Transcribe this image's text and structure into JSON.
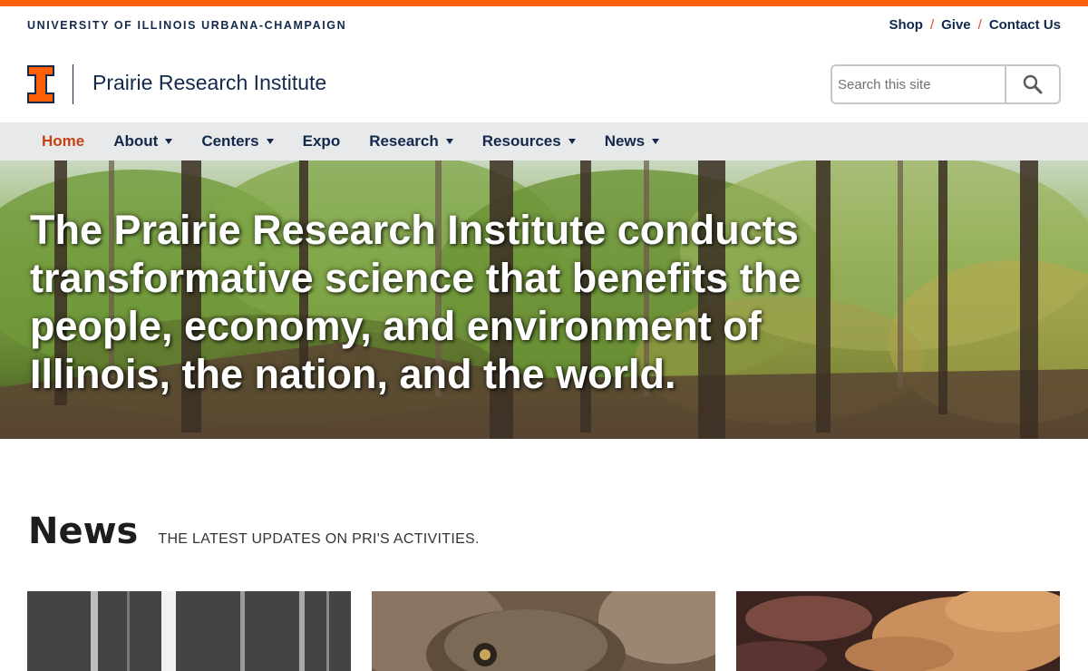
{
  "header": {
    "university": "UNIVERSITY OF ILLINOIS URBANA-CHAMPAIGN",
    "utility_links": [
      "Shop",
      "Give",
      "Contact Us"
    ],
    "site_title": "Prairie Research Institute",
    "search_placeholder": "Search this site"
  },
  "nav": {
    "items": [
      {
        "label": "Home",
        "active": true,
        "dropdown": false
      },
      {
        "label": "About",
        "active": false,
        "dropdown": true
      },
      {
        "label": "Centers",
        "active": false,
        "dropdown": true
      },
      {
        "label": "Expo",
        "active": false,
        "dropdown": false
      },
      {
        "label": "Research",
        "active": false,
        "dropdown": true
      },
      {
        "label": "Resources",
        "active": false,
        "dropdown": true
      },
      {
        "label": "News",
        "active": false,
        "dropdown": true
      }
    ]
  },
  "hero": {
    "text": "The Prairie Research Institute conducts transformative science that benefits the people, economy, and environment of Illinois, the nation, and the world."
  },
  "news": {
    "title": "News",
    "subtitle": "THE LATEST UPDATES ON PRI'S ACTIVITIES."
  },
  "colors": {
    "orange": "#ff5f05",
    "navy": "#13294b",
    "active_nav": "#c84113",
    "nav_bg": "#e8e9eb"
  }
}
